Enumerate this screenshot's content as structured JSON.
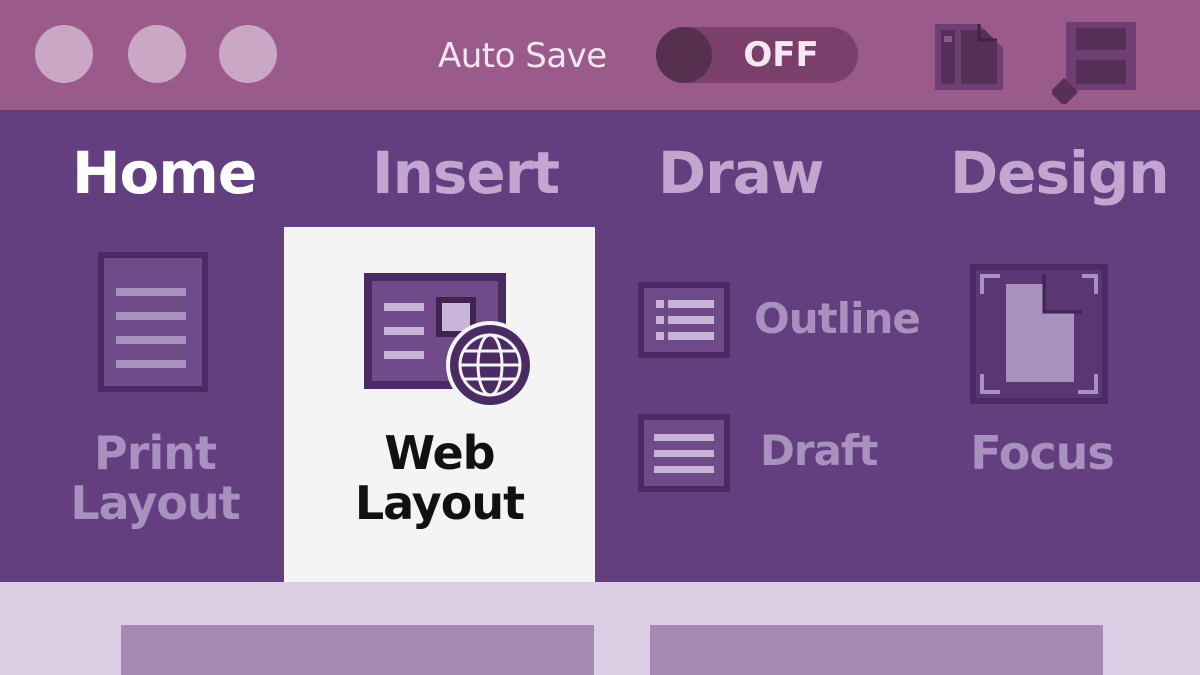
{
  "titlebar": {
    "window_buttons": [
      "close",
      "minimize",
      "zoom"
    ],
    "autosave_label": "Auto Save",
    "autosave_state": "OFF",
    "icons": [
      "layout-panel-icon",
      "save-icon"
    ]
  },
  "ribbon": {
    "tabs": [
      {
        "label": "Home",
        "active": true
      },
      {
        "label": "Insert",
        "active": false
      },
      {
        "label": "Draw",
        "active": false
      },
      {
        "label": "Design",
        "active": false
      }
    ]
  },
  "views": {
    "print_layout": {
      "line1": "Print",
      "line2": "Layout",
      "icon": "print-layout-icon"
    },
    "web_layout": {
      "line1": "Web",
      "line2": "Layout",
      "icon": "web-layout-icon",
      "selected": true
    },
    "outline": {
      "label": "Outline",
      "icon": "outline-icon"
    },
    "draft": {
      "label": "Draft",
      "icon": "draft-icon"
    },
    "focus": {
      "label": "Focus",
      "icon": "focus-icon"
    }
  },
  "colors": {
    "titlebar": "#9a5b8a",
    "ribbon": "#643f80",
    "selected_view": "#f4f4f4",
    "document_area": "#ddcde5"
  }
}
